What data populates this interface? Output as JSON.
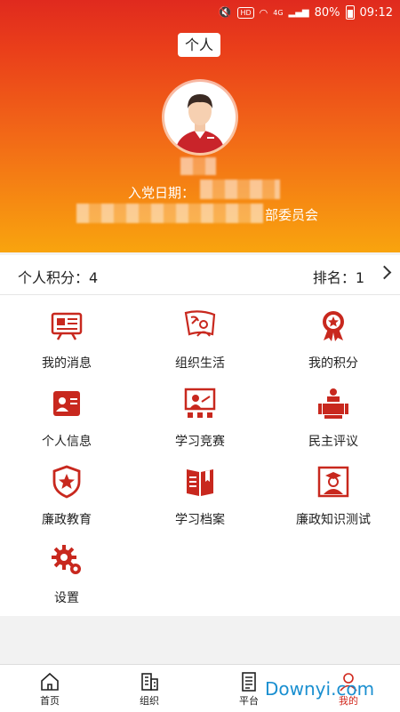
{
  "status_bar": {
    "network": "HD",
    "signal": "4G",
    "battery": "80%",
    "time": "09:12"
  },
  "header": {
    "title": "个人",
    "join_date_label": "入党日期：",
    "organization_suffix": "部委员会"
  },
  "score_bar": {
    "score": "个人积分：4",
    "rank": "排名：1"
  },
  "menu": [
    {
      "label": "我的消息",
      "icon": "message-board-icon"
    },
    {
      "label": "组织生活",
      "icon": "party-flag-icon"
    },
    {
      "label": "我的积分",
      "icon": "medal-icon"
    },
    {
      "label": "个人信息",
      "icon": "id-card-icon"
    },
    {
      "label": "学习竞赛",
      "icon": "lecture-icon"
    },
    {
      "label": "民主评议",
      "icon": "meeting-icon"
    },
    {
      "label": "廉政教育",
      "icon": "star-shield-icon"
    },
    {
      "label": "学习档案",
      "icon": "book-icon"
    },
    {
      "label": "廉政知识测试",
      "icon": "graduate-portrait-icon"
    },
    {
      "label": "设置",
      "icon": "gear-icon"
    }
  ],
  "tabs": [
    {
      "label": "首页",
      "icon": "home-icon"
    },
    {
      "label": "组织",
      "icon": "building-icon"
    },
    {
      "label": "平台",
      "icon": "document-icon"
    },
    {
      "label": "我的",
      "icon": "user-icon"
    }
  ],
  "watermark": "Downyi.com",
  "colors": {
    "accent": "#c8281e",
    "header_top": "#e02a1e",
    "header_bottom": "#f9a40e"
  }
}
